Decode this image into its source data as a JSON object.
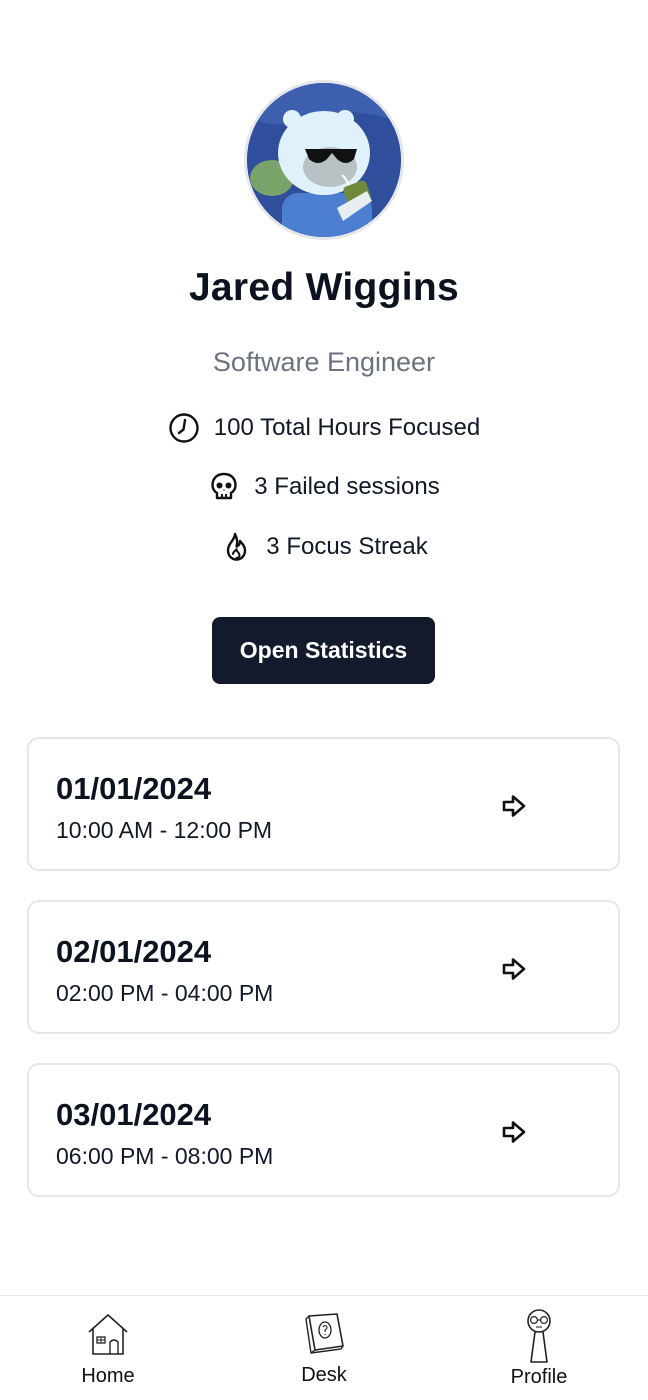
{
  "profile": {
    "name": "Jared Wiggins",
    "role": "Software Engineer",
    "avatar_icon": "avatar-cartoon"
  },
  "stats": {
    "hours": {
      "icon": "clock-icon",
      "label": "100 Total Hours Focused"
    },
    "failed": {
      "icon": "skull-icon",
      "label": "3 Failed sessions"
    },
    "streak": {
      "icon": "flame-icon",
      "label": "3 Focus Streak"
    }
  },
  "actions": {
    "open_statistics_label": "Open Statistics"
  },
  "sessions": [
    {
      "date": "01/01/2024",
      "time": "10:00 AM - 12:00 PM"
    },
    {
      "date": "02/01/2024",
      "time": "02:00 PM - 04:00 PM"
    },
    {
      "date": "03/01/2024",
      "time": "06:00 PM - 08:00 PM"
    }
  ],
  "nav": {
    "home": {
      "label": "Home",
      "icon": "house-icon"
    },
    "desk": {
      "label": "Desk",
      "icon": "book-icon"
    },
    "profile": {
      "label": "Profile",
      "icon": "person-icon"
    }
  },
  "colors": {
    "primary_button": "#131a2b",
    "text_muted": "#6b7280",
    "card_border": "#e5e7eb"
  }
}
